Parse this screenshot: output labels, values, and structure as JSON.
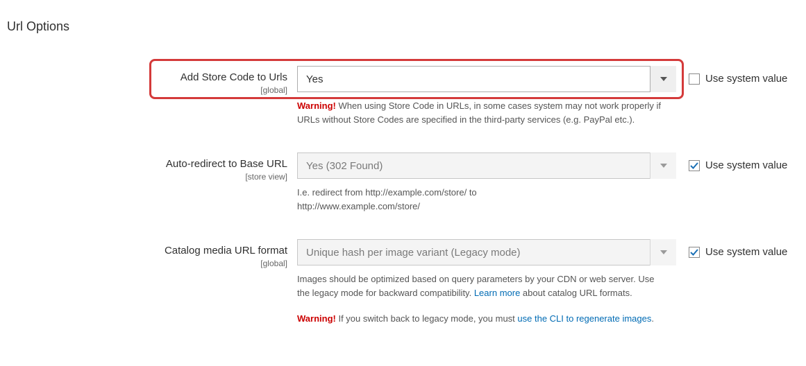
{
  "section_title": "Url Options",
  "use_system_value_label": "Use system value",
  "fields": {
    "add_store_code": {
      "label": "Add Store Code to Urls",
      "scope": "[global]",
      "value": "Yes",
      "disabled": false,
      "use_system": false,
      "note_warning_prefix": "Warning!",
      "note": " When using Store Code in URLs, in some cases system may not work properly if URLs without Store Codes are specified in the third-party services (e.g. PayPal etc.)."
    },
    "auto_redirect": {
      "label": "Auto-redirect to Base URL",
      "scope": "[store view]",
      "value": "Yes (302 Found)",
      "disabled": true,
      "use_system": true,
      "note": "I.e. redirect from http://example.com/store/ to http://www.example.com/store/"
    },
    "catalog_media": {
      "label": "Catalog media URL format",
      "scope": "[global]",
      "value": "Unique hash per image variant (Legacy mode)",
      "disabled": true,
      "use_system": true,
      "note_before_link": "Images should be optimized based on query parameters by your CDN or web server. Use the legacy mode for backward compatibility. ",
      "note_link": "Learn more",
      "note_after_link": " about catalog URL formats.",
      "warn_prefix": "Warning!",
      "warn_before_link": " If you switch back to legacy mode, you must ",
      "warn_link": "use the CLI to regenerate images",
      "warn_after": "."
    }
  }
}
